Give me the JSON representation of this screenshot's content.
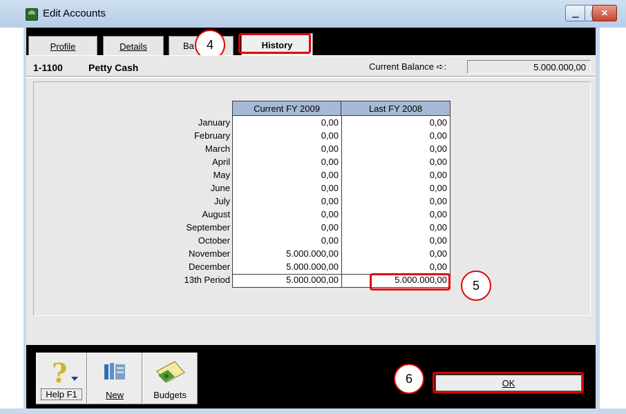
{
  "window": {
    "title": "Edit Accounts"
  },
  "tabs": [
    {
      "label": "Profile",
      "underline": "P"
    },
    {
      "label": "Details",
      "underline": "D"
    },
    {
      "label": "Ba",
      "underline": ""
    },
    {
      "label": "History",
      "underline": ""
    }
  ],
  "account": {
    "number": "1-1100",
    "name": "Petty Cash"
  },
  "balance": {
    "label": "Current Balance ➪:",
    "value": "5.000.000,00"
  },
  "history_table": {
    "columns": [
      "Current FY 2009",
      "Last FY 2008"
    ],
    "rows": [
      {
        "month": "January",
        "current": "0,00",
        "last": "0,00"
      },
      {
        "month": "February",
        "current": "0,00",
        "last": "0,00"
      },
      {
        "month": "March",
        "current": "0,00",
        "last": "0,00"
      },
      {
        "month": "April",
        "current": "0,00",
        "last": "0,00"
      },
      {
        "month": "May",
        "current": "0,00",
        "last": "0,00"
      },
      {
        "month": "June",
        "current": "0,00",
        "last": "0,00"
      },
      {
        "month": "July",
        "current": "0,00",
        "last": "0,00"
      },
      {
        "month": "August",
        "current": "0,00",
        "last": "0,00"
      },
      {
        "month": "September",
        "current": "0,00",
        "last": "0,00"
      },
      {
        "month": "October",
        "current": "0,00",
        "last": "0,00"
      },
      {
        "month": "November",
        "current": "5.000.000,00",
        "last": "0,00"
      },
      {
        "month": "December",
        "current": "5.000.000,00",
        "last": "0,00"
      },
      {
        "month": "13th Period",
        "current": "5.000.000,00",
        "last": "5.000.000,00"
      }
    ]
  },
  "toolbar": {
    "help_label": "Help F1",
    "new_label": "New",
    "budgets_label": "Budgets"
  },
  "ok_label": "OK",
  "annotations": {
    "step4": "4",
    "step5": "5",
    "step6": "6"
  },
  "colors": {
    "highlight": "#e00000",
    "header_bg": "#a6b9d6"
  }
}
